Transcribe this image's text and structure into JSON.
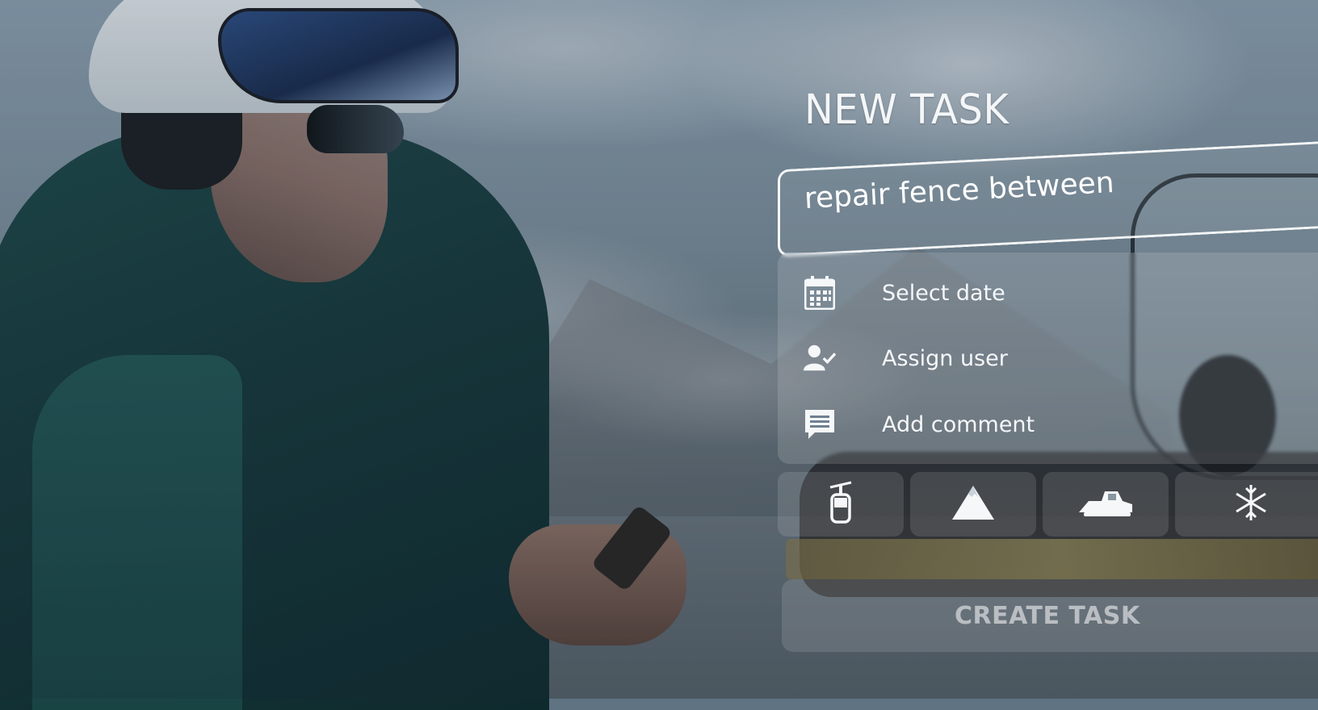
{
  "panel": {
    "title": "NEW TASK",
    "task_input_value": "repair fence between",
    "options": [
      {
        "icon": "calendar-icon",
        "label": "Select date"
      },
      {
        "icon": "user-check-icon",
        "label": "Assign user"
      },
      {
        "icon": "comment-icon",
        "label": "Add comment"
      }
    ],
    "categories": [
      {
        "icon": "lift-gondola-icon"
      },
      {
        "icon": "mountain-icon"
      },
      {
        "icon": "snowplow-icon"
      },
      {
        "icon": "snowflake-icon"
      }
    ],
    "create_button_label": "CREATE TASK"
  },
  "colors": {
    "overlay_text": "#ffffff",
    "overlay_card": "rgba(255,255,255,0.14)",
    "jacket": "#1f4a4a"
  }
}
